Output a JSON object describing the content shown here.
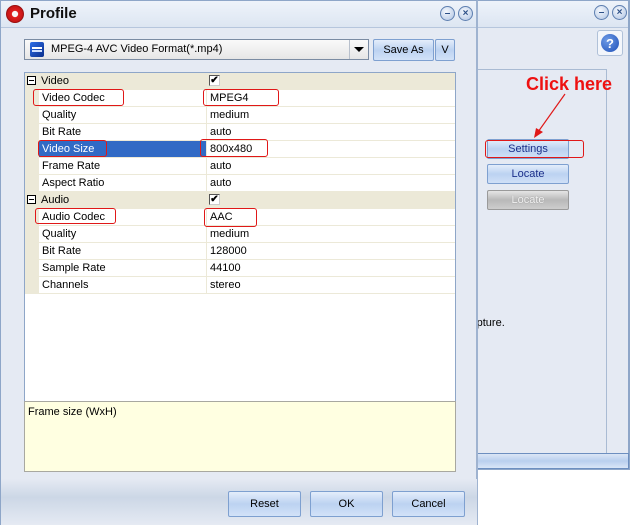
{
  "background_window": {
    "buttons": {
      "settings": "Settings",
      "locate": "Locate",
      "locate_disabled": "Locate"
    },
    "partial_text": "capture.",
    "help_icon": "?",
    "minimize_icon": "–",
    "close_icon": "×"
  },
  "annotation": {
    "text": "Click here",
    "color": "#ee1111"
  },
  "dialog": {
    "title": "Profile",
    "format": {
      "selected": "MPEG-4 AVC Video Format(*.mp4)"
    },
    "save_as_label": "Save As",
    "v_label": "V",
    "minimize_icon": "–",
    "close_icon": "×",
    "groups": [
      {
        "name": "Video",
        "enabled": true,
        "properties": [
          {
            "name": "Video Codec",
            "value": "MPEG4"
          },
          {
            "name": "Quality",
            "value": "medium"
          },
          {
            "name": "Bit Rate",
            "value": "auto"
          },
          {
            "name": "Video Size",
            "value": "800x480"
          },
          {
            "name": "Frame Rate",
            "value": "auto"
          },
          {
            "name": "Aspect Ratio",
            "value": "auto"
          }
        ]
      },
      {
        "name": "Audio",
        "enabled": true,
        "properties": [
          {
            "name": "Audio Codec",
            "value": "AAC"
          },
          {
            "name": "Quality",
            "value": "medium"
          },
          {
            "name": "Bit Rate",
            "value": "128000"
          },
          {
            "name": "Sample Rate",
            "value": "44100"
          },
          {
            "name": "Channels",
            "value": "stereo"
          }
        ]
      }
    ],
    "selected_property": "Video Size",
    "check_glyph": "✔",
    "description": "Frame size (WxH)",
    "buttons": {
      "reset": "Reset",
      "ok": "OK",
      "cancel": "Cancel"
    }
  }
}
